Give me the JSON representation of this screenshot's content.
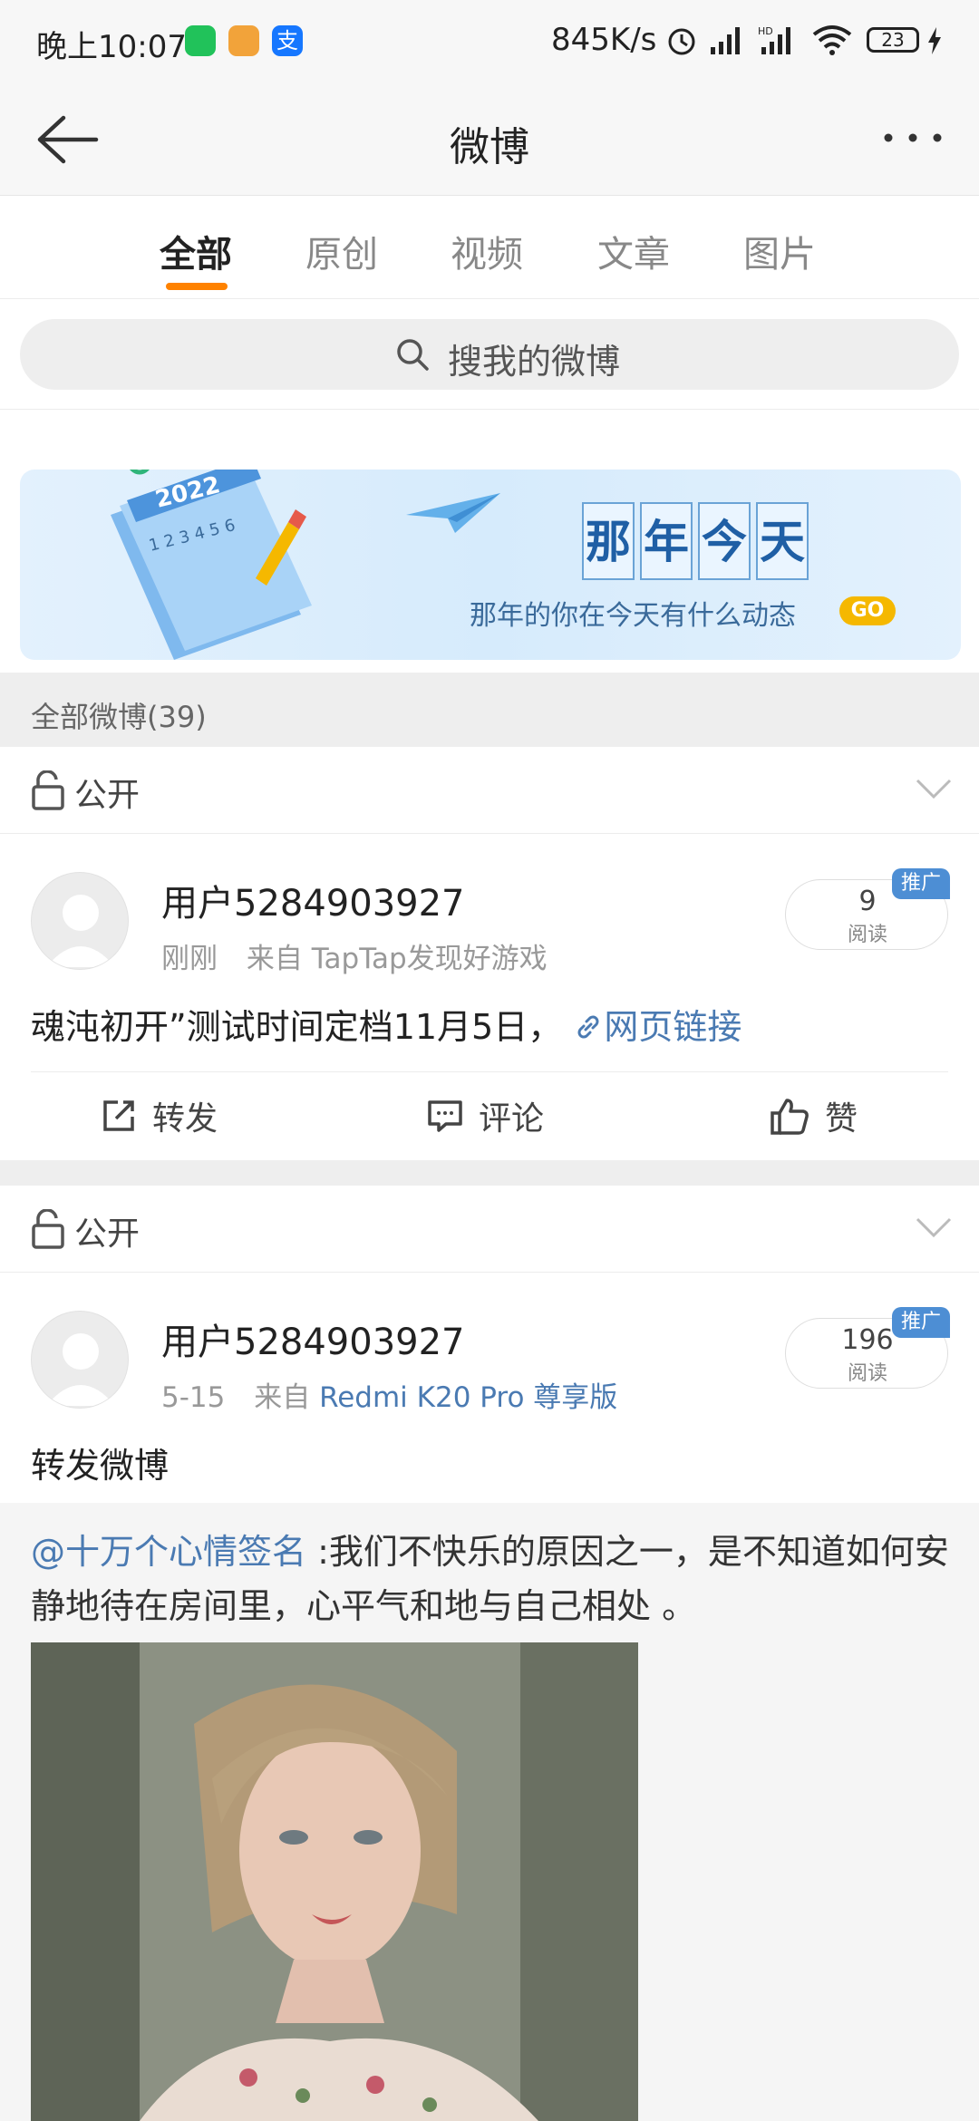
{
  "status": {
    "time": "晚上10:07",
    "speed": "845K/s",
    "battery": "23"
  },
  "header": {
    "title": "微博"
  },
  "tabs": [
    {
      "label": "全部",
      "active": true
    },
    {
      "label": "原创"
    },
    {
      "label": "视频"
    },
    {
      "label": "文章"
    },
    {
      "label": "图片"
    }
  ],
  "search": {
    "placeholder": "搜我的微博"
  },
  "banner": {
    "title_chars": [
      "那",
      "年",
      "今",
      "天"
    ],
    "subtitle": "那年的你在今天有什么动态",
    "go": "GO",
    "calendar_year": "2022",
    "calendar_numbers": "1 2 3 4 5 6"
  },
  "section": {
    "label": "全部微博(39)"
  },
  "posts": [
    {
      "visibility": "公开",
      "username": "用户5284903927",
      "time": "刚刚",
      "from_label": "来自",
      "source": "TapTap发现好游戏",
      "reads": "9",
      "reads_label": "阅读",
      "promo": "推广",
      "text": "魂沌初开”测试时间定档11月5日，",
      "link": "网页链接",
      "actions": {
        "repost": "转发",
        "comment": "评论",
        "like": "赞"
      }
    },
    {
      "visibility": "公开",
      "username": "用户5284903927",
      "time": "5-15",
      "from_label": "来自",
      "source": "Redmi K20 Pro 尊享版",
      "reads": "196",
      "reads_label": "阅读",
      "promo": "推广",
      "text": "转发微博",
      "repost_at": "@十万个心情签名",
      "repost_text": " :我们不快乐的原因之一，是不知道如何安静地待在房间里，心平气和地与自己相处 。"
    }
  ],
  "colors": {
    "accent": "#ff8200",
    "link": "#4a7ab2",
    "promo": "#4d8ed4"
  }
}
